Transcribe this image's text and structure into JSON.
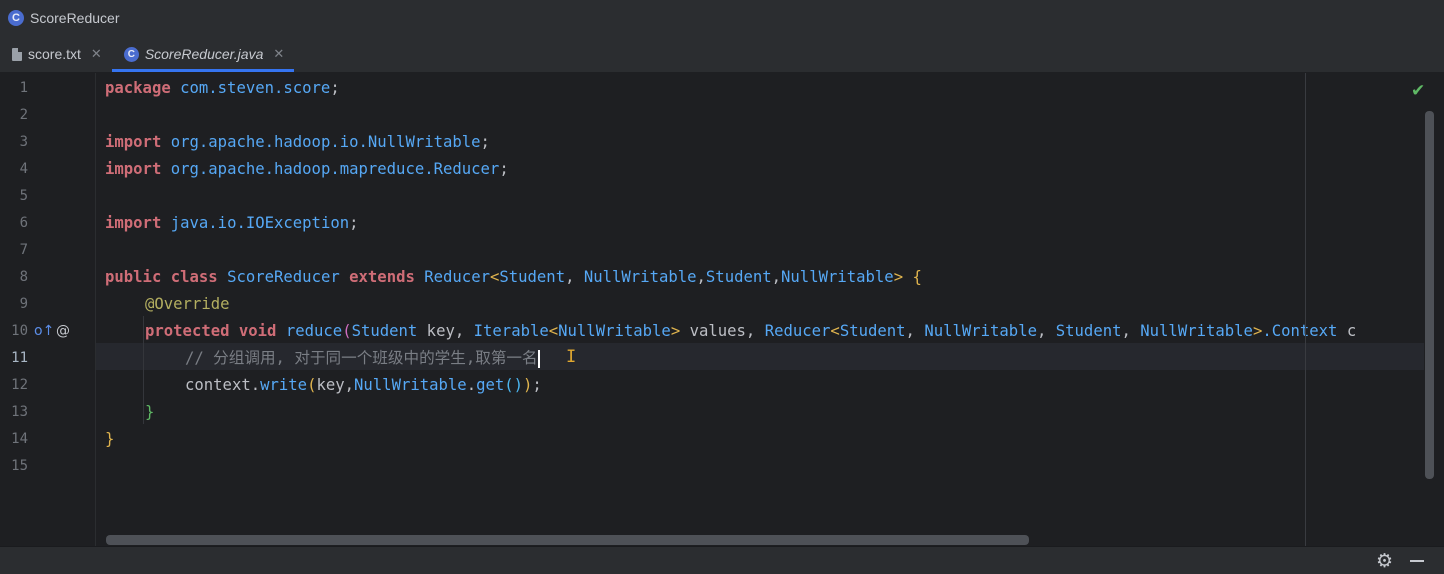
{
  "window": {
    "title": "ScoreReducer"
  },
  "tabs": [
    {
      "label": "score.txt",
      "icon": "text-file-icon",
      "active": false
    },
    {
      "label": "ScoreReducer.java",
      "icon": "java-class-icon",
      "active": true
    }
  ],
  "editor": {
    "current_line": 11,
    "line_numbers": [
      "1",
      "2",
      "3",
      "4",
      "5",
      "6",
      "7",
      "8",
      "9",
      "10",
      "11",
      "12",
      "13",
      "14",
      "15"
    ],
    "status": "no-problems-check-icon",
    "lines": {
      "l1": {
        "kw": "package",
        "name": "com.steven.score",
        "end": ";"
      },
      "l3": {
        "kw": "import",
        "name": "org.apache.hadoop.io.NullWritable",
        "end": ";"
      },
      "l4": {
        "kw": "import",
        "name": "org.apache.hadoop.mapreduce.Reducer",
        "end": ";"
      },
      "l6": {
        "kw": "import",
        "name": "java.io.IOException",
        "end": ";"
      },
      "l8": {
        "kw1": "public",
        "kw2": "class",
        "name": "ScoreReducer",
        "kw3": "extends",
        "super": "Reducer",
        "lt": "<",
        "t1": "Student",
        "sep1": ", ",
        "t2": "NullWritable",
        "sep2": ",",
        "t3": "Student",
        "sep3": ",",
        "t4": "NullWritable",
        "gt": ">",
        "brace": "{"
      },
      "l9": {
        "annotation": "@Override"
      },
      "l10": {
        "kw1": "protected",
        "kw2": "void",
        "method": "reduce",
        "open": "(",
        "p1type": "Student",
        "p1name": " key, ",
        "p2type": "Iterable",
        "p2lt": "<",
        "p2arg": "NullWritable",
        "p2gt": ">",
        "p2name": " values, ",
        "p3type": "Reducer",
        "p3lt": "<",
        "p3a1": "Student",
        "p3s1": ", ",
        "p3a2": "NullWritable",
        "p3s2": ", ",
        "p3a3": "Student",
        "p3s3": ", ",
        "p3a4": "NullWritable",
        "p3gt": ">",
        "p3ctx": ".Context",
        "tail": " c"
      },
      "l11": {
        "comment": "// 分组调用, 对于同一个班级中的学生,取第一名"
      },
      "l12": {
        "obj": "context",
        "dot": ".",
        "method": "write",
        "open": "(",
        "arg1": "key,",
        "cls": "NullWritable",
        "dot2": ".",
        "m2": "get",
        "inner": "()",
        "close": ")",
        "end": ";"
      },
      "l13": {
        "brace": "}"
      },
      "l14": {
        "brace": "}"
      }
    }
  },
  "bottom": {
    "settings": "gear-icon",
    "minimize": "minimize-icon"
  }
}
